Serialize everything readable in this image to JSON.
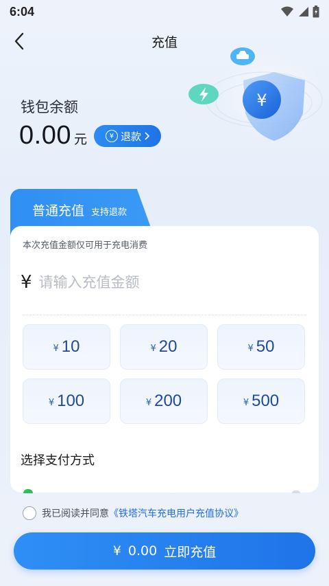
{
  "status": {
    "time": "6:04"
  },
  "nav": {
    "title": "充值"
  },
  "wallet": {
    "label": "钱包余额",
    "amount": "0.00",
    "unit": "元",
    "refund_label": "退款",
    "refund_symbol": "¥"
  },
  "tab": {
    "title": "普通充值",
    "subtitle": "支持退款"
  },
  "card": {
    "note": "本次充值金额仅可用于充电消费"
  },
  "amount_input": {
    "currency": "¥",
    "placeholder": "请输入充值金额",
    "value": ""
  },
  "presets": [
    {
      "symbol": "¥",
      "value": "10"
    },
    {
      "symbol": "¥",
      "value": "20"
    },
    {
      "symbol": "¥",
      "value": "50"
    },
    {
      "symbol": "¥",
      "value": "100"
    },
    {
      "symbol": "¥",
      "value": "200"
    },
    {
      "symbol": "¥",
      "value": "500"
    }
  ],
  "payment": {
    "title": "选择支付方式"
  },
  "agreement": {
    "prefix": "我已阅读并同意",
    "link": "《铁塔汽车充电用户充值协议》"
  },
  "submit": {
    "currency": "¥",
    "amount": "0.00",
    "label": "立即充值"
  },
  "colors": {
    "primary": "#1f74e8",
    "background": "#eef3fb",
    "card": "#ffffff"
  },
  "icons": [
    "wifi-icon",
    "signal-icon",
    "battery-icon",
    "back-arrow-icon",
    "refund-icon",
    "shield-yen-icon",
    "lightning-bubble-icon",
    "car-bubble-icon"
  ]
}
